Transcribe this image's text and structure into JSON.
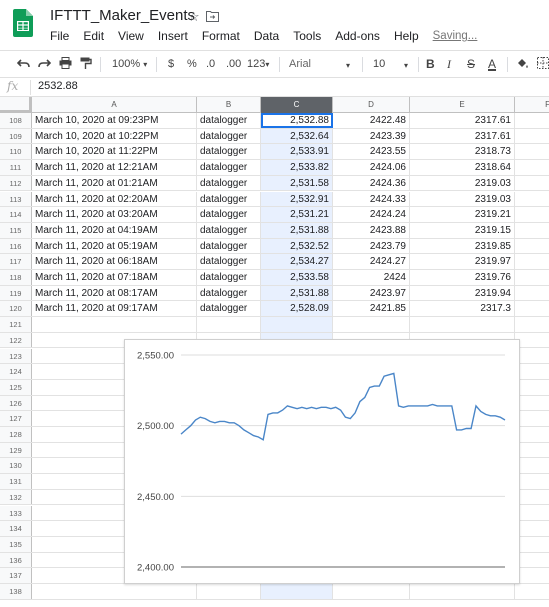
{
  "app": {
    "title": "IFTTT_Maker_Events",
    "menus": [
      "File",
      "Edit",
      "View",
      "Insert",
      "Format",
      "Data",
      "Tools",
      "Add-ons",
      "Help"
    ],
    "status": "Saving..."
  },
  "toolbar": {
    "zoom": "100%",
    "currency": "$",
    "percent": "%",
    "dec_decrease": ".0",
    "dec_increase": ".00",
    "more_formats": "123",
    "font": "Arial",
    "font_size": "10",
    "bold": "B",
    "italic": "I",
    "strike": "S",
    "text_color": "A",
    "colors": {
      "text_color_bar": "#000000",
      "accent": "#1a73e8"
    }
  },
  "formula_bar": {
    "fx": "fx",
    "value": "2532.88"
  },
  "columns": [
    "A",
    "B",
    "C",
    "D",
    "E",
    "F"
  ],
  "selected_column": "C",
  "rows": [
    {
      "n": "108",
      "a": "March 10, 2020 at 09:23PM",
      "b": "datalogger",
      "c": "2,532.88",
      "d": "2422.48",
      "e": "2317.61"
    },
    {
      "n": "109",
      "a": "March 10, 2020 at 10:22PM",
      "b": "datalogger",
      "c": "2,532.64",
      "d": "2423.39",
      "e": "2317.61"
    },
    {
      "n": "110",
      "a": "March 10, 2020 at 11:22PM",
      "b": "datalogger",
      "c": "2,533.91",
      "d": "2423.55",
      "e": "2318.73"
    },
    {
      "n": "111",
      "a": "March 11, 2020 at 12:21AM",
      "b": "datalogger",
      "c": "2,533.82",
      "d": "2424.06",
      "e": "2318.64"
    },
    {
      "n": "112",
      "a": "March 11, 2020 at 01:21AM",
      "b": "datalogger",
      "c": "2,531.58",
      "d": "2424.36",
      "e": "2319.03"
    },
    {
      "n": "113",
      "a": "March 11, 2020 at 02:20AM",
      "b": "datalogger",
      "c": "2,532.91",
      "d": "2424.33",
      "e": "2319.03"
    },
    {
      "n": "114",
      "a": "March 11, 2020 at 03:20AM",
      "b": "datalogger",
      "c": "2,531.21",
      "d": "2424.24",
      "e": "2319.21"
    },
    {
      "n": "115",
      "a": "March 11, 2020 at 04:19AM",
      "b": "datalogger",
      "c": "2,531.88",
      "d": "2423.88",
      "e": "2319.15"
    },
    {
      "n": "116",
      "a": "March 11, 2020 at 05:19AM",
      "b": "datalogger",
      "c": "2,532.52",
      "d": "2423.79",
      "e": "2319.85"
    },
    {
      "n": "117",
      "a": "March 11, 2020 at 06:18AM",
      "b": "datalogger",
      "c": "2,534.27",
      "d": "2424.27",
      "e": "2319.97"
    },
    {
      "n": "118",
      "a": "March 11, 2020 at 07:18AM",
      "b": "datalogger",
      "c": "2,533.58",
      "d": "2424",
      "e": "2319.76"
    },
    {
      "n": "119",
      "a": "March 11, 2020 at 08:17AM",
      "b": "datalogger",
      "c": "2,531.88",
      "d": "2423.97",
      "e": "2319.94"
    },
    {
      "n": "120",
      "a": "March 11, 2020 at 09:17AM",
      "b": "datalogger",
      "c": "2,528.09",
      "d": "2421.85",
      "e": "2317.3"
    }
  ],
  "empty_rows": [
    "121",
    "122",
    "123",
    "124",
    "125",
    "126",
    "127",
    "128",
    "129",
    "130",
    "131",
    "132",
    "133",
    "134",
    "135",
    "136",
    "137",
    "138"
  ],
  "chart_data": {
    "type": "line",
    "title": "",
    "xlabel": "",
    "ylabel": "",
    "ylim": [
      2400,
      2550
    ],
    "yticks": [
      "2,550.00",
      "2,500.00",
      "2,450.00",
      "2,400.00"
    ],
    "ytick_values": [
      2550,
      2500,
      2450,
      2400
    ],
    "grid": true,
    "legend": "none",
    "color": "#4a86c8",
    "series": [
      {
        "values": [
          2494,
          2497,
          2500,
          2504,
          2506,
          2505,
          2503,
          2502,
          2503,
          2503,
          2502,
          2502,
          2500,
          2497,
          2495,
          2493,
          2492,
          2490,
          2508,
          2509,
          2509,
          2511,
          2514,
          2513,
          2512,
          2513,
          2512,
          2513,
          2512,
          2513,
          2513,
          2512,
          2513,
          2511,
          2506,
          2505,
          2509,
          2517,
          2520,
          2527,
          2528,
          2528,
          2535,
          2536,
          2537,
          2514,
          2513,
          2514,
          2514,
          2514,
          2514,
          2514,
          2515,
          2514,
          2514,
          2514,
          2514,
          2497,
          2497,
          2498,
          2498,
          2514,
          2510,
          2508,
          2507,
          2507,
          2506,
          2504
        ]
      }
    ]
  }
}
